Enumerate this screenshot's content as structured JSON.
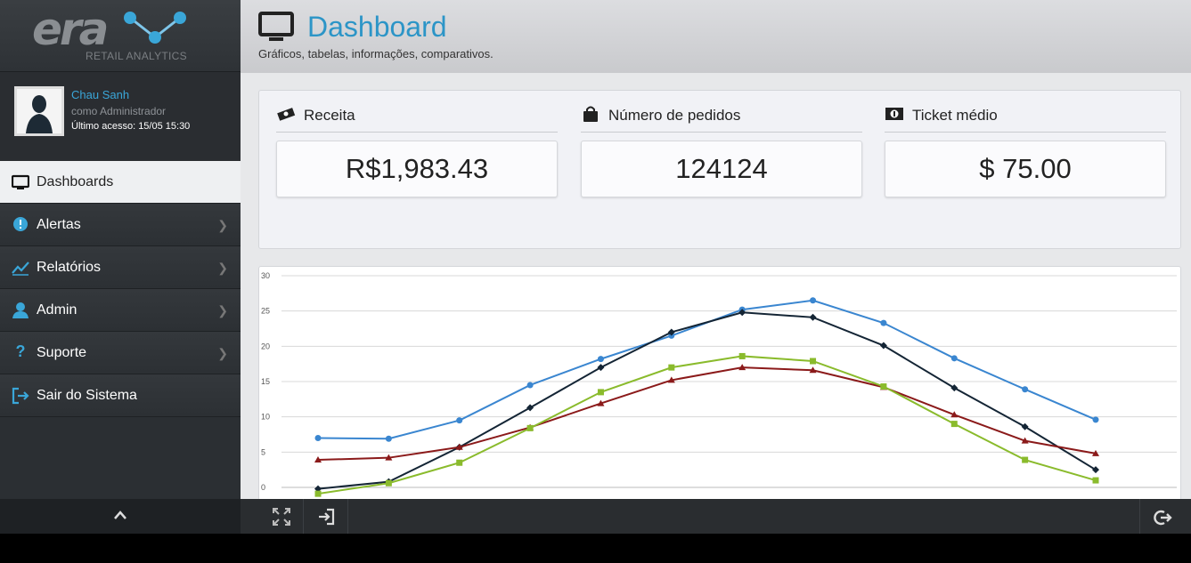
{
  "brand": {
    "logo_text": "era",
    "tagline": "RETAIL ANALYTICS"
  },
  "user": {
    "name": "Chau Sanh",
    "role": "como Administrador",
    "last_access": "Último acesso: 15/05 15:30"
  },
  "nav": {
    "items": [
      {
        "label": "Dashboards",
        "icon": "monitor-icon"
      },
      {
        "label": "Alertas",
        "icon": "exclamation-icon"
      },
      {
        "label": "Relatórios",
        "icon": "line-chart-icon"
      },
      {
        "label": "Admin",
        "icon": "user-icon"
      },
      {
        "label": "Suporte",
        "icon": "question-icon"
      },
      {
        "label": "Sair do Sistema",
        "icon": "logout-icon"
      }
    ]
  },
  "header": {
    "title": "Dashboard",
    "subtitle": "Gráficos, tabelas, informações, comparativos."
  },
  "stats": [
    {
      "title": "Receita",
      "value": "R$1,983.43",
      "icon": "money-icon"
    },
    {
      "title": "Número de pedidos",
      "value": "124124",
      "icon": "bag-icon"
    },
    {
      "title": "Ticket médio",
      "value": "$ 75.00",
      "icon": "cash-icon"
    }
  ],
  "colors": {
    "accent": "#2c95c7",
    "sidebar": "#2b2f33"
  },
  "chart_data": {
    "type": "line",
    "ylim": [
      0,
      30
    ],
    "yticks": [
      "0",
      "5",
      "10",
      "15",
      "20",
      "25",
      "30"
    ],
    "x": [
      1,
      2,
      3,
      4,
      5,
      6,
      7,
      8,
      9,
      10,
      11,
      12
    ],
    "series": [
      {
        "color": "#3a86d0",
        "marker": "circle",
        "values": [
          7.0,
          6.9,
          9.5,
          14.5,
          18.2,
          21.5,
          25.2,
          26.5,
          23.3,
          18.3,
          13.9,
          9.6
        ]
      },
      {
        "color": "#142535",
        "marker": "diamond",
        "values": [
          -0.2,
          0.8,
          5.7,
          11.3,
          17.0,
          22.0,
          24.8,
          24.1,
          20.1,
          14.1,
          8.6,
          2.5
        ]
      },
      {
        "color": "#8b1a1a",
        "marker": "triangle",
        "values": [
          3.9,
          4.2,
          5.7,
          8.5,
          11.9,
          15.2,
          17.0,
          16.6,
          14.2,
          10.3,
          6.6,
          4.8
        ]
      },
      {
        "color": "#8abb2c",
        "marker": "square",
        "values": [
          -0.9,
          0.6,
          3.5,
          8.4,
          13.5,
          17.0,
          18.6,
          17.9,
          14.3,
          9.0,
          3.9,
          1.0
        ]
      }
    ]
  }
}
